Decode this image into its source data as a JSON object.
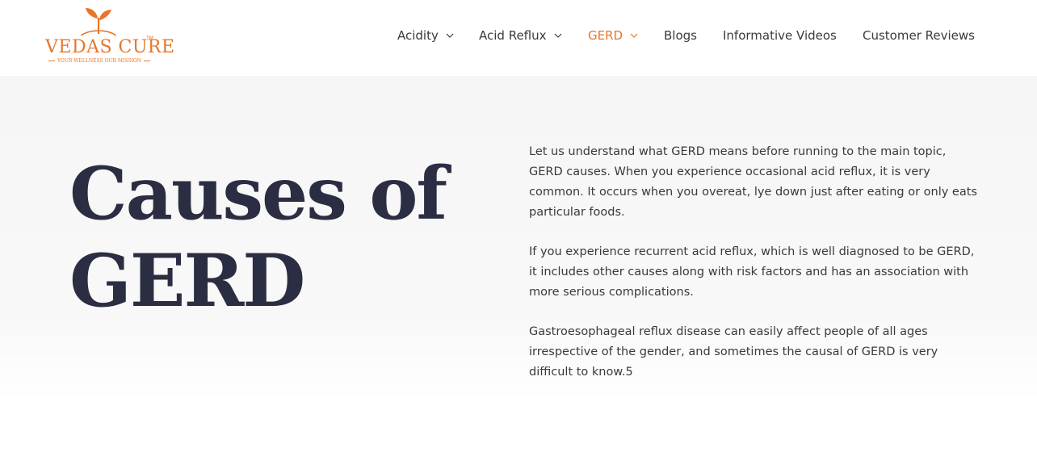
{
  "brand": {
    "name": "VEDAS CURE",
    "tm": "TM",
    "tagline": "YOUR WELLNESS OUR MISSION",
    "color": "#e8762a"
  },
  "nav": {
    "items": [
      {
        "label": "Acidity",
        "has_dropdown": true,
        "active": false
      },
      {
        "label": "Acid Reflux",
        "has_dropdown": true,
        "active": false
      },
      {
        "label": "GERD",
        "has_dropdown": true,
        "active": true
      },
      {
        "label": "Blogs",
        "has_dropdown": false,
        "active": false
      },
      {
        "label": "Informative Videos",
        "has_dropdown": false,
        "active": false
      },
      {
        "label": "Customer Reviews",
        "has_dropdown": false,
        "active": false
      }
    ],
    "active_color": "#e8762a"
  },
  "hero": {
    "title_line1": "Causes of",
    "title_line2": "GERD",
    "paragraphs": [
      "Let us understand what GERD means before running to the main topic, GERD causes. When you experience occasional acid reflux, it is very common. It occurs when you overeat, lye down just after eating or only eats particular foods.",
      "If you experience recurrent acid reflux, which is well diagnosed to be GERD, it includes other causes along with risk factors and has an association with more serious complications.",
      "Gastroesophageal reflux disease can easily affect people of all ages irrespective of the gender, and sometimes the causal of GERD is very difficult to know.5"
    ]
  }
}
